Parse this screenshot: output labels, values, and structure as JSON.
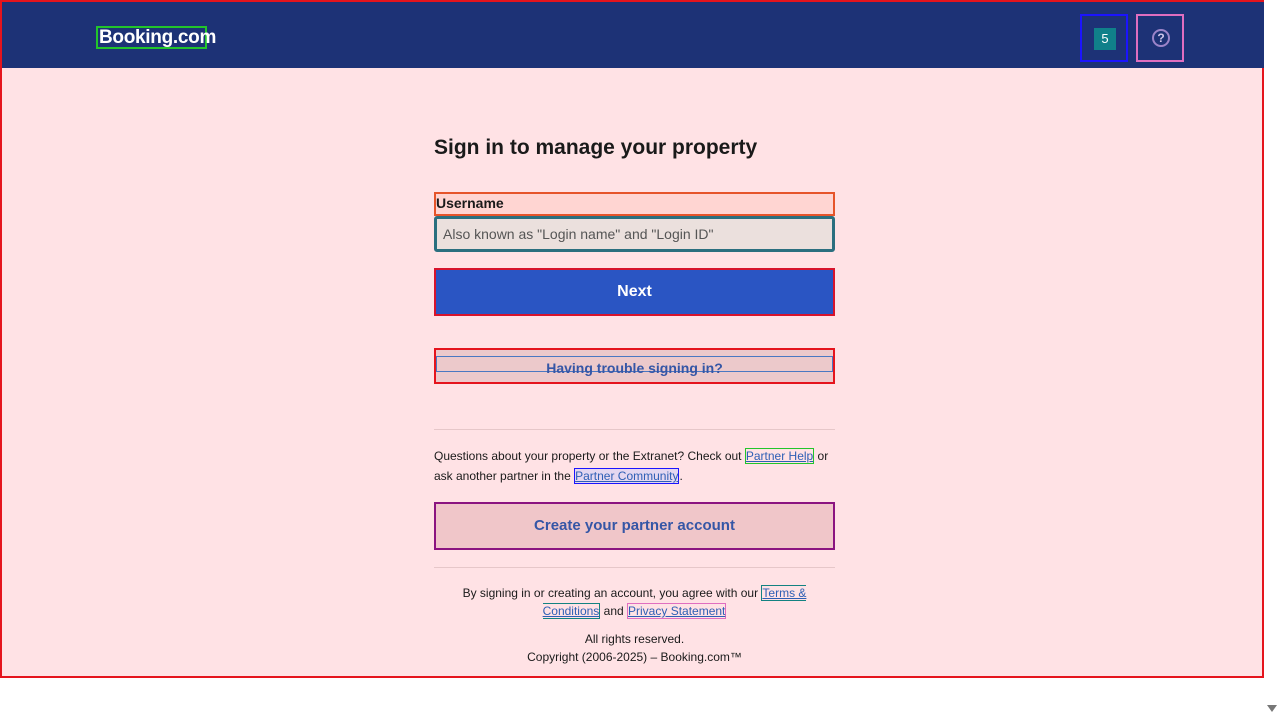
{
  "header": {
    "logo": "Booking.com",
    "language_flag": "5",
    "help_glyph": "?"
  },
  "main": {
    "title": "Sign in to manage your property",
    "username_label": "Username",
    "username_placeholder": "Also known as \"Login name\" and \"Login ID\"",
    "next_label": "Next",
    "trouble_label": "Having trouble signing in?",
    "questions_prefix": "Questions about your property or the Extranet? Check out ",
    "partner_help": "Partner Help",
    "questions_middle": " or ask another partner in the ",
    "partner_community": "Partner Community",
    "questions_suffix": ".",
    "create_account_label": "Create your partner account"
  },
  "footer": {
    "terms_prefix": "By signing in or creating an account, you agree with our ",
    "terms_link": "Terms & Conditions",
    "terms_and": " and ",
    "privacy_link": "Privacy Statement",
    "rights": "All rights reserved.",
    "copyright": "Copyright (2006-2025) – Booking.com™"
  },
  "colors": {
    "header_bg": "#1d3276",
    "primary_button": "#2a55c3",
    "link": "#2e5fb5"
  }
}
